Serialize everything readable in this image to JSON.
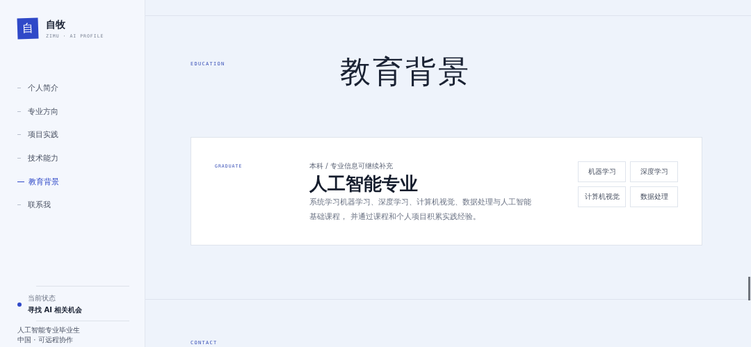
{
  "brand": {
    "logo_char": "自",
    "name": "自牧",
    "subtitle": "ZIMU · AI PROFILE"
  },
  "nav": [
    {
      "label": "个人简介",
      "selected": false
    },
    {
      "label": "专业方向",
      "selected": false
    },
    {
      "label": "项目实践",
      "selected": false
    },
    {
      "label": "技术能力",
      "selected": false
    },
    {
      "label": "教育背景",
      "selected": true
    },
    {
      "label": "联系我",
      "selected": false
    }
  ],
  "status": {
    "label": "当前状态",
    "value": "寻找 AI 相关机会"
  },
  "footer": [
    "人工智能专业毕业生",
    "中国 · 可远程协作"
  ],
  "education": {
    "eyebrow": "EDUCATION",
    "title": "教育背景",
    "card": {
      "level_tag": "GRADUATE",
      "crumb": "本科 / 专业信息可继续补充",
      "major": "人工智能专业",
      "description": "系统学习机器学习、深度学习、计算机视觉、数据处理与人工智能基础课程， 并通过课程和个人项目积累实践经验。",
      "tags": [
        "机器学习",
        "深度学习",
        "计算机视觉",
        "数据处理"
      ]
    }
  },
  "contact": {
    "eyebrow": "CONTACT"
  }
}
